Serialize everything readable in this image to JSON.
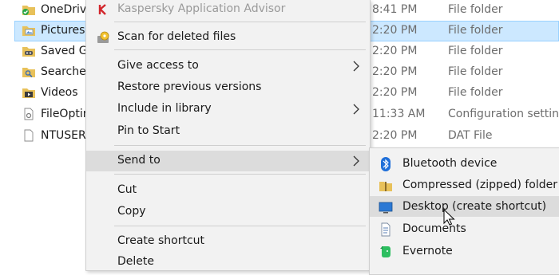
{
  "explorer": {
    "files": [
      {
        "name": "OneDrive",
        "date": "8:41 PM",
        "type": "File folder",
        "icon": "onedrive-folder-icon"
      },
      {
        "name": "Pictures",
        "date": "2:20 PM",
        "type": "File folder",
        "icon": "pictures-folder-icon",
        "selected": true
      },
      {
        "name": "Saved Ga",
        "date": "2:20 PM",
        "type": "File folder",
        "icon": "saved-games-folder-icon"
      },
      {
        "name": "Searches",
        "date": "2:20 PM",
        "type": "File folder",
        "icon": "searches-folder-icon"
      },
      {
        "name": "Videos",
        "date": "2:20 PM",
        "type": "File folder",
        "icon": "videos-folder-icon"
      },
      {
        "name": "FileOptin",
        "date": "11:33 AM",
        "type": "Configuration setting",
        "icon": "config-file-icon"
      },
      {
        "name": "NTUSER.",
        "date": "2:20 PM",
        "type": "DAT File",
        "icon": "dat-file-icon"
      }
    ]
  },
  "context_menu": {
    "kaspersky": "Kaspersky Application Advisor",
    "scan": "Scan for deleted files",
    "give_access": "Give access to",
    "restore": "Restore previous versions",
    "include_library": "Include in library",
    "pin_start": "Pin to Start",
    "send_to": "Send to",
    "cut": "Cut",
    "copy": "Copy",
    "create_shortcut": "Create shortcut",
    "delete": "Delete"
  },
  "send_to_menu": {
    "bluetooth": "Bluetooth device",
    "compressed": "Compressed (zipped) folder",
    "desktop": "Desktop (create shortcut)",
    "documents": "Documents",
    "evernote": "Evernote"
  },
  "colors": {
    "selection_bg": "#cce8ff",
    "menu_bg": "#f2f2f2",
    "menu_highlight": "#dcdcdc"
  }
}
